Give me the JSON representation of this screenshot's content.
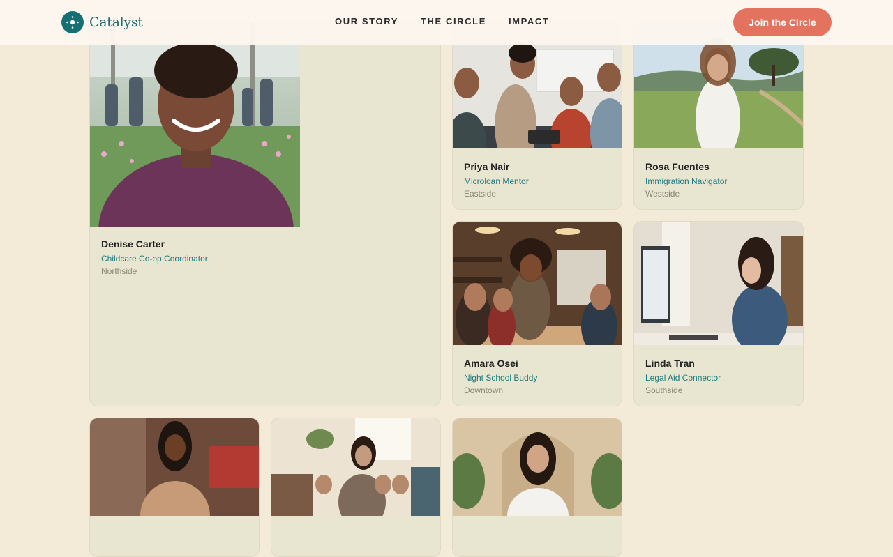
{
  "brand": {
    "name": "Catalyst"
  },
  "nav": [
    {
      "label": "OUR STORY"
    },
    {
      "label": "THE CIRCLE"
    },
    {
      "label": "IMPACT"
    }
  ],
  "cta": {
    "label": "Join the Circle"
  },
  "members": [
    {
      "name": "Denise Carter",
      "role": "Childcare Co-op Coordinator",
      "area": "Northside"
    },
    {
      "name": "Priya Nair",
      "role": "Microloan Mentor",
      "area": "Eastside"
    },
    {
      "name": "Rosa Fuentes",
      "role": "Immigration Navigator",
      "area": "Westside"
    },
    {
      "name": "Amara Osei",
      "role": "Night School Buddy",
      "area": "Downtown"
    },
    {
      "name": "Linda Tran",
      "role": "Legal Aid Connector",
      "area": "Southside"
    }
  ],
  "colors": {
    "background": "#f3ead8",
    "brand": "#166f73",
    "accent": "#e3735e",
    "card": "#e8e5d1"
  }
}
